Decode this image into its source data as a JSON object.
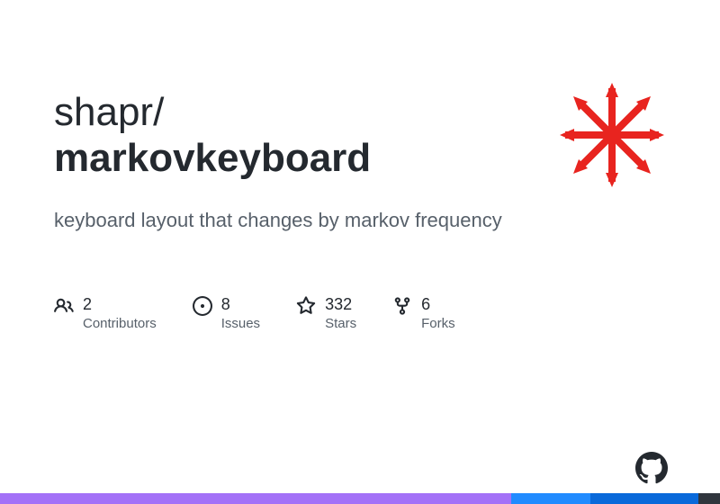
{
  "repo": {
    "owner": "shapr",
    "separator": "/",
    "name": "markovkeyboard",
    "description": "keyboard layout that changes by markov frequency"
  },
  "stats": {
    "contributors": {
      "count": "2",
      "label": "Contributors"
    },
    "issues": {
      "count": "8",
      "label": "Issues"
    },
    "stars": {
      "count": "332",
      "label": "Stars"
    },
    "forks": {
      "count": "6",
      "label": "Forks"
    }
  }
}
